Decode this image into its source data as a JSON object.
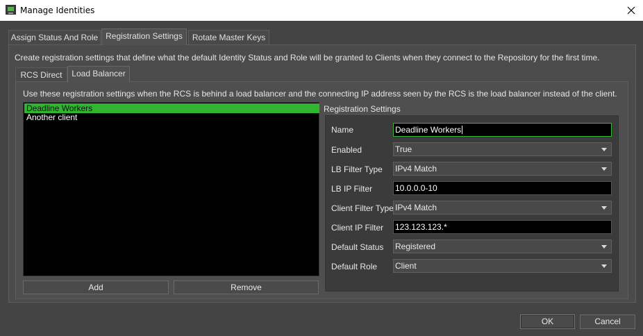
{
  "window": {
    "title": "Manage Identities"
  },
  "tabs": [
    {
      "label": "Assign Status And Role"
    },
    {
      "label": "Registration Settings"
    },
    {
      "label": "Rotate Master Keys"
    }
  ],
  "registration_description": "Create registration settings that define what the default Identity Status and Role will be granted to Clients when they connect to the Repository for the first time.",
  "subtabs": [
    {
      "label": "RCS Direct"
    },
    {
      "label": "Load Balancer"
    }
  ],
  "load_balancer_description": "Use these registration settings when the RCS is behind a load balancer and the connecting IP address seen by the RCS is the load balancer instead of the client.",
  "clients": [
    {
      "name": "Deadline Workers"
    },
    {
      "name": "Another client"
    }
  ],
  "list_buttons": {
    "add": "Add",
    "remove": "Remove"
  },
  "settings": {
    "title": "Registration Settings",
    "name_label": "Name",
    "name_value": "Deadline Workers",
    "enabled_label": "Enabled",
    "enabled_value": "True",
    "lb_filter_type_label": "LB Filter Type",
    "lb_filter_type_value": "IPv4 Match",
    "lb_ip_filter_label": "LB IP Filter",
    "lb_ip_filter_value": "10.0.0.0-10",
    "client_filter_type_label": "Client Filter Type",
    "client_filter_type_value": "IPv4 Match",
    "client_ip_filter_label": "Client IP Filter",
    "client_ip_filter_value": "123.123.123.*",
    "default_status_label": "Default Status",
    "default_status_value": "Registered",
    "default_role_label": "Default Role",
    "default_role_value": "Client"
  },
  "dialog_buttons": {
    "ok": "OK",
    "cancel": "Cancel"
  },
  "colors": {
    "accent": "#2fb52f",
    "background": "#444444"
  }
}
